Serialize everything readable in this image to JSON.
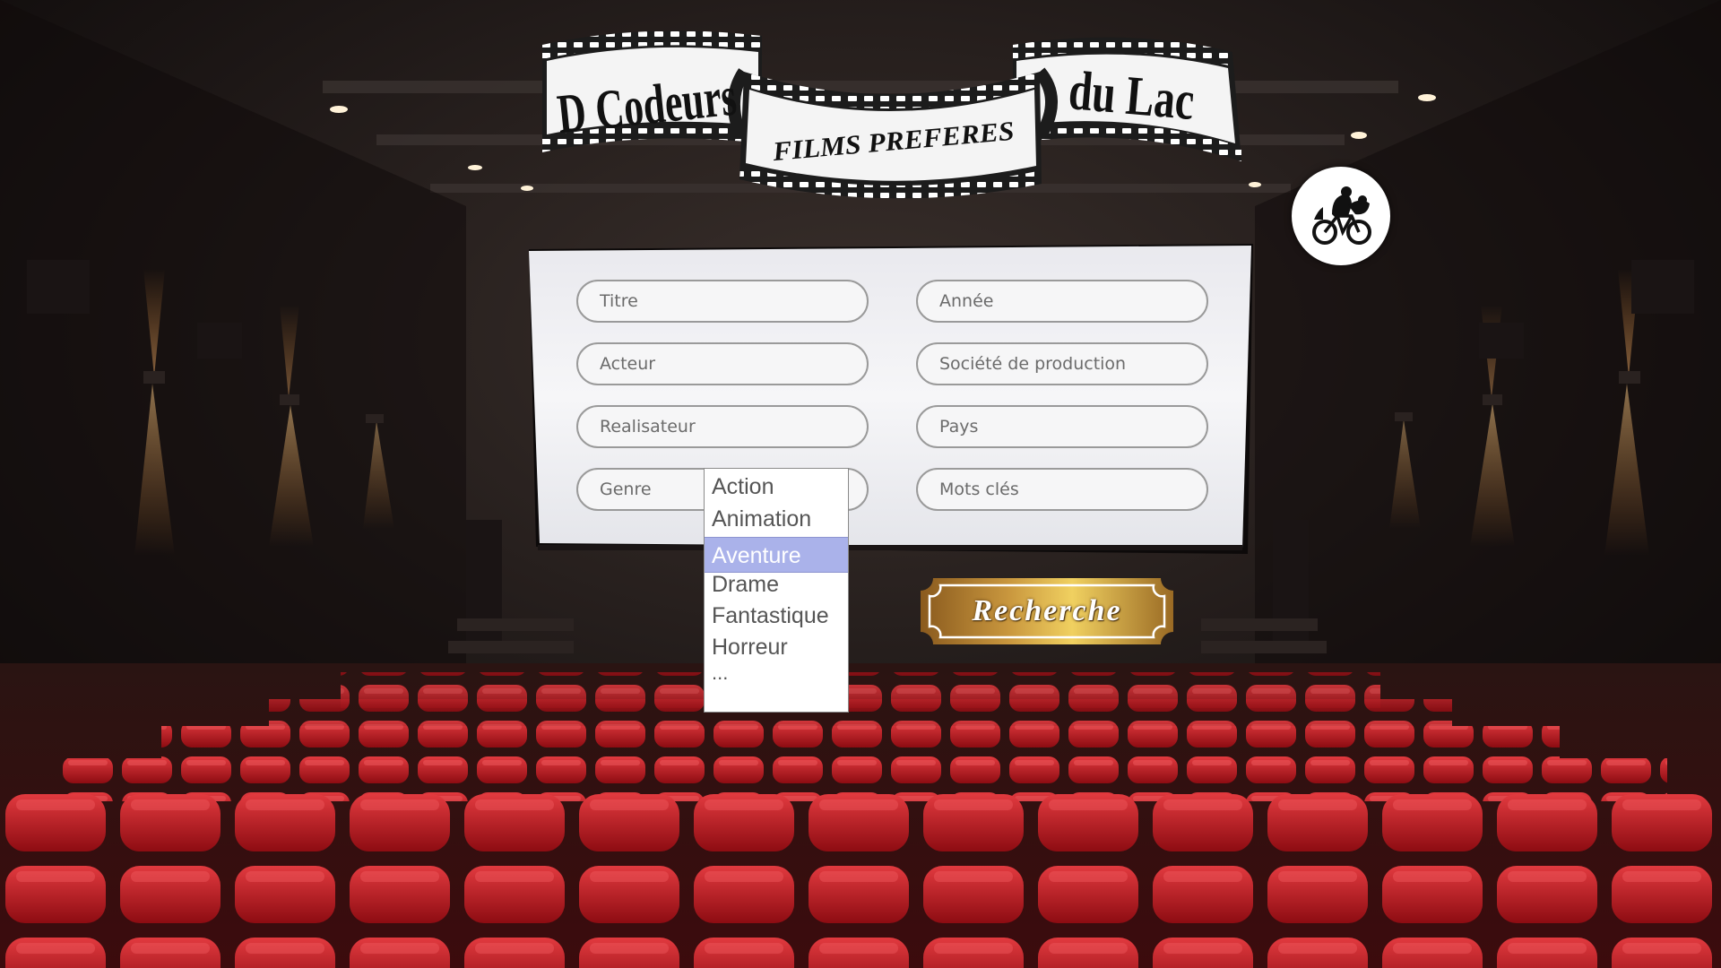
{
  "logo": {
    "left_text": "D Codeurs",
    "right_text": "du Lac",
    "center_text": "FILMS PREFERES"
  },
  "avatar": {
    "icon": "et-bicycle-icon"
  },
  "form": {
    "titre_placeholder": "Titre",
    "annee_placeholder": "Année",
    "acteur_placeholder": "Acteur",
    "societe_placeholder": "Société de production",
    "realisateur_placeholder": "Realisateur",
    "pays_placeholder": "Pays",
    "genre_placeholder": "Genre",
    "mots_cles_placeholder": "Mots clés"
  },
  "genre_dropdown": {
    "options": [
      "Action",
      "Animation",
      "Aventure",
      "Drame",
      "Fantastique",
      "Horreur",
      "..."
    ],
    "selected": "Aventure",
    "highlight_color": "#aab2ea"
  },
  "search_button": {
    "label": "Recherche"
  },
  "colors": {
    "seat_red": "#c8141c",
    "screen_white": "#f2f2f4",
    "ticket_gold": "#b88a3a"
  }
}
